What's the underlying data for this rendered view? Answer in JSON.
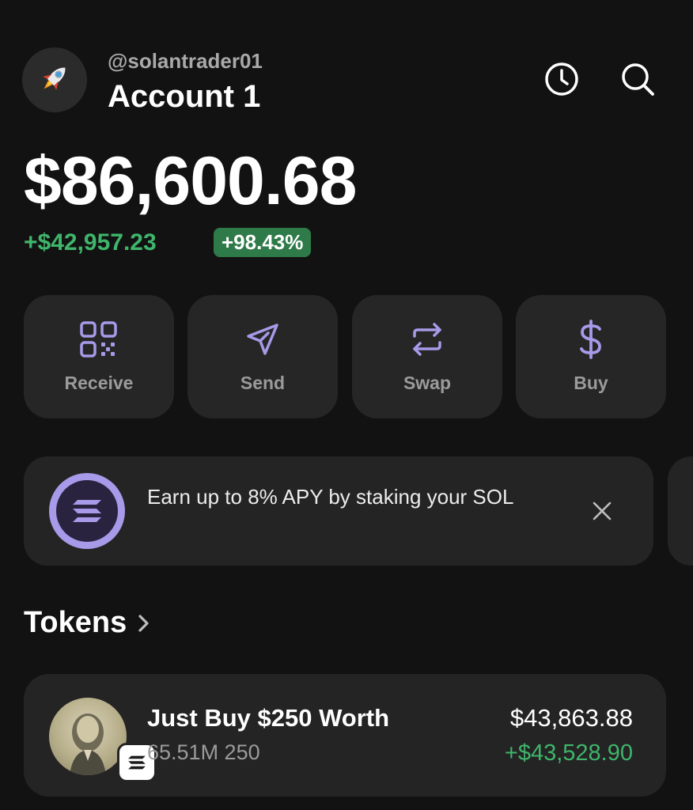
{
  "account": {
    "handle": "@solantrader01",
    "name": "Account 1",
    "avatar_icon": "rocket-icon"
  },
  "header": {
    "history_icon": "clock-icon",
    "search_icon": "search-icon"
  },
  "portfolio": {
    "balance": "$86,600.68",
    "change_amount": "+$42,957.23",
    "change_percent": "+98.43%"
  },
  "actions": [
    {
      "label": "Receive",
      "icon": "qr-code-icon"
    },
    {
      "label": "Send",
      "icon": "send-icon"
    },
    {
      "label": "Swap",
      "icon": "swap-icon"
    },
    {
      "label": "Buy",
      "icon": "dollar-icon"
    }
  ],
  "banner": {
    "text": "Earn up to 8% APY by staking your SOL",
    "icon": "solana-icon",
    "close_icon": "close-icon"
  },
  "tokens": {
    "title": "Tokens",
    "items": [
      {
        "name": "Just Buy $250 Worth",
        "amount": "65.51M 250",
        "value": "$43,863.88",
        "change": "+$43,528.90"
      }
    ]
  },
  "colors": {
    "background": "#121212",
    "card": "#262626",
    "accent_purple": "#a79ae8",
    "positive_green": "#3fb56b",
    "badge_green": "#2f7a49"
  }
}
